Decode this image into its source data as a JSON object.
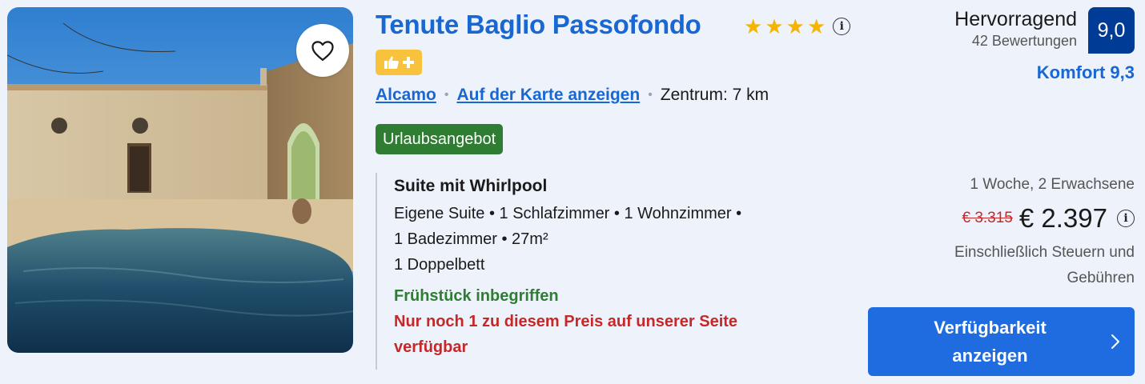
{
  "hotel": {
    "name": "Tenute Baglio Passofondo",
    "star_count": 4,
    "favorite_icon": "heart-outline-icon",
    "badge_icon": "thumbs-up-plus-icon"
  },
  "location": {
    "city": "Alcamo",
    "map_link": "Auf der Karte anzeigen",
    "distance": "Zentrum: 7 km"
  },
  "deal_badge": "Urlaubsangebot",
  "room": {
    "name": "Suite mit Whirlpool",
    "detail_line1": "Eigene Suite • 1 Schlafzimmer • 1 Wohnzimmer •",
    "detail_line2": "1 Badezimmer • 27m²",
    "detail_line3": "1 Doppelbett",
    "breakfast": "Frühstück inbegriffen",
    "scarcity_line1": "Nur noch 1 zu diesem Preis auf unserer Seite",
    "scarcity_line2": "verfügbar"
  },
  "review": {
    "word": "Hervorragend",
    "count": "42 Bewertungen",
    "score": "9,0",
    "komfort": "Komfort 9,3"
  },
  "pricing": {
    "stay": "1 Woche, 2 Erwachsene",
    "old_price": "€ 3.315",
    "price": "€ 2.397",
    "taxes_line1": "Einschließlich Steuern und",
    "taxes_line2": "Gebühren"
  },
  "cta": {
    "line1": "Verfügbarkeit",
    "line2": "anzeigen"
  },
  "colors": {
    "link_blue": "#1967d2",
    "score_bg": "#003b95",
    "deal_green": "#2f7d32",
    "alert_red": "#c62828",
    "cta_blue": "#1f6be0",
    "badge_yellow": "#f8c23c"
  }
}
